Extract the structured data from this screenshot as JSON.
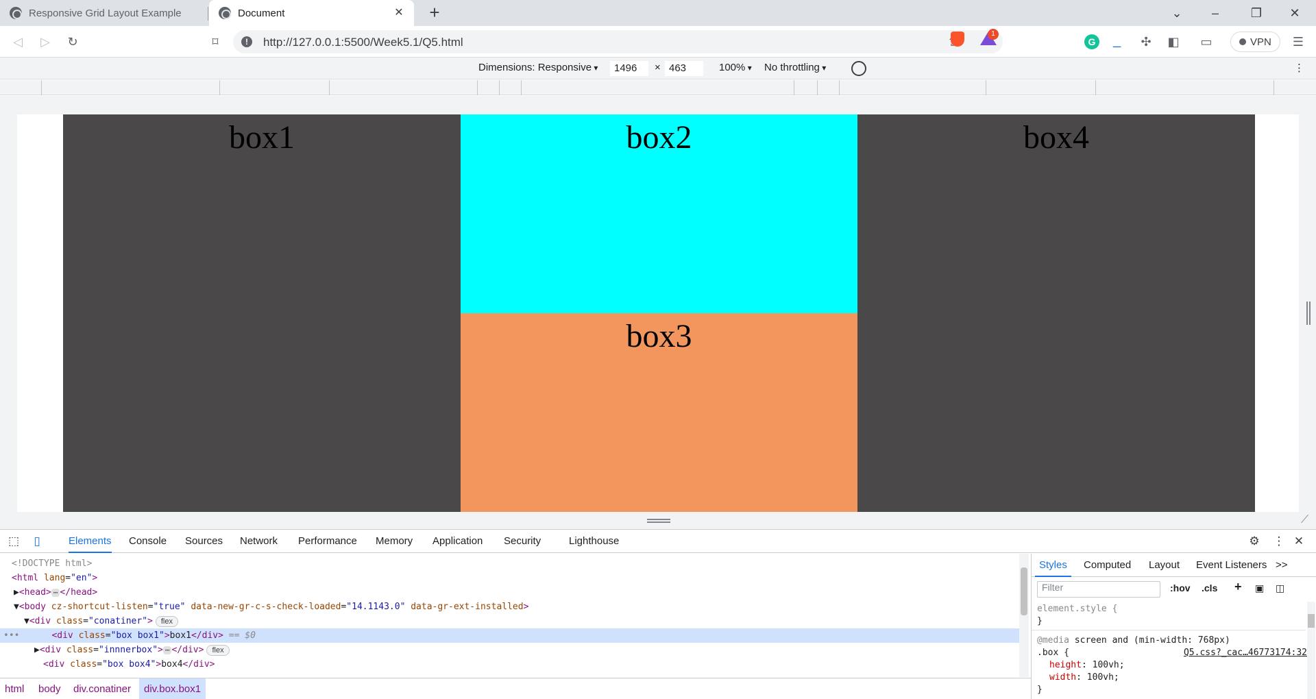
{
  "browser": {
    "tabs": [
      {
        "title": "Responsive Grid Layout Example",
        "active": false
      },
      {
        "title": "Document",
        "active": true
      }
    ],
    "url": "http://127.0.0.1:5500/Week5.1/Q5.html",
    "reward_badge_count": "1",
    "vpn_label": "VPN",
    "extension_letter": "G",
    "extension_underscore": "_"
  },
  "device_toolbar": {
    "dimensions_label": "Dimensions: Responsive",
    "width": "1496",
    "times": "×",
    "height": "463",
    "zoom": "100%",
    "throttling": "No throttling"
  },
  "page": {
    "boxes": [
      {
        "label": "box1",
        "color": "#4a4849"
      },
      {
        "label": "box2",
        "color": "#00ffff"
      },
      {
        "label": "box3",
        "color": "#f2965e"
      },
      {
        "label": "box4",
        "color": "#4a4849"
      }
    ]
  },
  "devtools": {
    "tabs": [
      "Elements",
      "Console",
      "Sources",
      "Network",
      "Performance",
      "Memory",
      "Application",
      "Security",
      "Lighthouse"
    ],
    "active_tab": "Elements",
    "dom": {
      "doctype": "<!DOCTYPE html>",
      "html_open": "<html",
      "html_attr_name": "lang",
      "html_attr_value": "\"en\"",
      "html_close": ">",
      "head_open": "<head>",
      "head_close": "</head>",
      "body_open": "<body",
      "body_attr1_name": "cz-shortcut-listen",
      "body_attr1_value": "\"true\"",
      "body_attr2_name": "data-new-gr-c-s-check-loaded",
      "body_attr2_value": "\"14.1143.0\"",
      "body_attr3_name": "data-gr-ext-installed",
      "body_close": ">",
      "div_open": "<div",
      "class_attr": "class",
      "container_class": "\"conatiner\"",
      "box1_class": "\"box box1\"",
      "box1_text": "box1",
      "innerbox_class": "\"innnerbox\"",
      "box4_class": "\"box box4\"",
      "box4_text": "box4",
      "div_end": "</div>",
      "gt": ">",
      "selected_marker": "== $0",
      "flex_badge": "flex",
      "ellipsis": "⋯",
      "gutter_dots": "•••"
    },
    "breadcrumbs": [
      "html",
      "body",
      "div.conatiner",
      "div.box.box1"
    ],
    "styles": {
      "tabs": [
        "Styles",
        "Computed",
        "Layout",
        "Event Listeners"
      ],
      "more": ">>",
      "filter_placeholder": "Filter",
      "hov": ":hov",
      "cls": ".cls",
      "element_style": "element.style {",
      "close_brace": "}",
      "media_keyword": "@media",
      "media_query": "screen and (min-width: 768px)",
      "selector": ".box {",
      "source": "Q5.css?_cac…46773174:32",
      "props": [
        {
          "name": "height",
          "value": "100vh;"
        },
        {
          "name": "width",
          "value": "100vh;"
        }
      ]
    }
  }
}
